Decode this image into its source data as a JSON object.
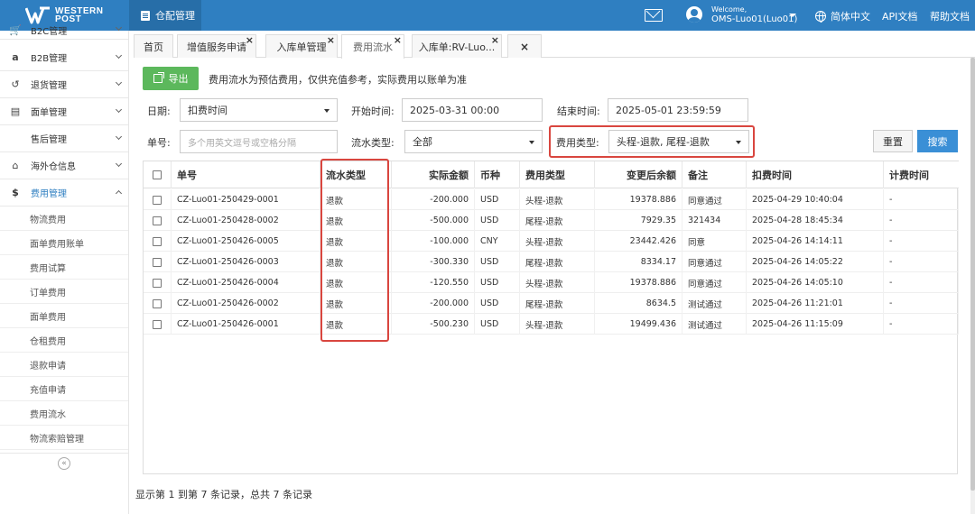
{
  "header": {
    "logo_text_line1": "WESTERN",
    "logo_text_line2": "POST",
    "module_label": "仓配管理",
    "welcome": "Welcome,",
    "username": "OMS-Luo01(Luo01)",
    "language": "简体中文",
    "api_docs": "API文档",
    "help_docs": "帮助文档",
    "brand_color": "#2f7fc1"
  },
  "sidebar": {
    "items": [
      {
        "label": "B2C管理",
        "icon": "cart-icon"
      },
      {
        "label": "B2B管理",
        "icon": "amazon-icon"
      },
      {
        "label": "退货管理",
        "icon": "return-icon"
      },
      {
        "label": "面单管理",
        "icon": "document-icon"
      },
      {
        "label": "售后管理",
        "icon": ""
      },
      {
        "label": "海外仓信息",
        "icon": "home-icon"
      },
      {
        "label": "费用管理",
        "icon": "dollar-icon"
      }
    ],
    "sub_items": [
      "物流费用",
      "面单费用账单",
      "费用试算",
      "订单费用",
      "面单费用",
      "仓租费用",
      "退款申请",
      "充值申请",
      "费用流水",
      "物流索赔管理"
    ],
    "collapse_glyph": "«"
  },
  "tabs": [
    {
      "label": "首页"
    },
    {
      "label": "增值服务申请"
    },
    {
      "label": "入库单管理"
    },
    {
      "label": "费用流水"
    },
    {
      "label": "入库单:RV-Luo..."
    }
  ],
  "tab_close_glyph": "×",
  "toolbar": {
    "export_label": "导出",
    "notice": "费用流水为预估费用，仅供充值参考，实际费用以账单为准"
  },
  "filters": {
    "date_label": "日期:",
    "date_value": "扣费时间",
    "start_label": "开始时间:",
    "start_value": "2025-03-31 00:00",
    "end_label": "结束时间:",
    "end_value": "2025-05-01 23:59:59",
    "order_label": "单号:",
    "order_placeholder": "多个用英文逗号或空格分隔",
    "flow_type_label": "流水类型:",
    "flow_type_value": "全部",
    "fee_type_label": "费用类型:",
    "fee_type_value": "头程-退款, 尾程-退款",
    "reset_label": "重置",
    "search_label": "搜索"
  },
  "table": {
    "columns": [
      "单号",
      "流水类型",
      "实际金额",
      "币种",
      "费用类型",
      "变更后余额",
      "备注",
      "扣费时间",
      "计费时间"
    ],
    "rows": [
      {
        "order": "CZ-Luo01-250429-0001",
        "flow": "退款",
        "amount": "-200.000",
        "currency": "USD",
        "fee_type": "头程-退款",
        "balance": "19378.886",
        "remark": "同意通过",
        "deduct_time": "2025-04-29 10:40:04",
        "bill_time": "-"
      },
      {
        "order": "CZ-Luo01-250428-0002",
        "flow": "退款",
        "amount": "-500.000",
        "currency": "USD",
        "fee_type": "尾程-退款",
        "balance": "7929.35",
        "remark": "321434",
        "deduct_time": "2025-04-28 18:45:34",
        "bill_time": "-"
      },
      {
        "order": "CZ-Luo01-250426-0005",
        "flow": "退款",
        "amount": "-100.000",
        "currency": "CNY",
        "fee_type": "头程-退款",
        "balance": "23442.426",
        "remark": "同意",
        "deduct_time": "2025-04-26 14:14:11",
        "bill_time": "-"
      },
      {
        "order": "CZ-Luo01-250426-0003",
        "flow": "退款",
        "amount": "-300.330",
        "currency": "USD",
        "fee_type": "尾程-退款",
        "balance": "8334.17",
        "remark": "同意通过",
        "deduct_time": "2025-04-26 14:05:22",
        "bill_time": "-"
      },
      {
        "order": "CZ-Luo01-250426-0004",
        "flow": "退款",
        "amount": "-120.550",
        "currency": "USD",
        "fee_type": "头程-退款",
        "balance": "19378.886",
        "remark": "同意通过",
        "deduct_time": "2025-04-26 14:05:10",
        "bill_time": "-"
      },
      {
        "order": "CZ-Luo01-250426-0002",
        "flow": "退款",
        "amount": "-200.000",
        "currency": "USD",
        "fee_type": "尾程-退款",
        "balance": "8634.5",
        "remark": "测试通过",
        "deduct_time": "2025-04-26 11:21:01",
        "bill_time": "-"
      },
      {
        "order": "CZ-Luo01-250426-0001",
        "flow": "退款",
        "amount": "-500.230",
        "currency": "USD",
        "fee_type": "头程-退款",
        "balance": "19499.436",
        "remark": "测试通过",
        "deduct_time": "2025-04-26 11:15:09",
        "bill_time": "-"
      }
    ]
  },
  "footer": {
    "info": "显示第 1 到第 7 条记录，总共 7 条记录"
  },
  "colors": {
    "highlight_frame": "#d9463f",
    "export_button": "#5cb85c",
    "search_button": "#3a8fd6"
  }
}
